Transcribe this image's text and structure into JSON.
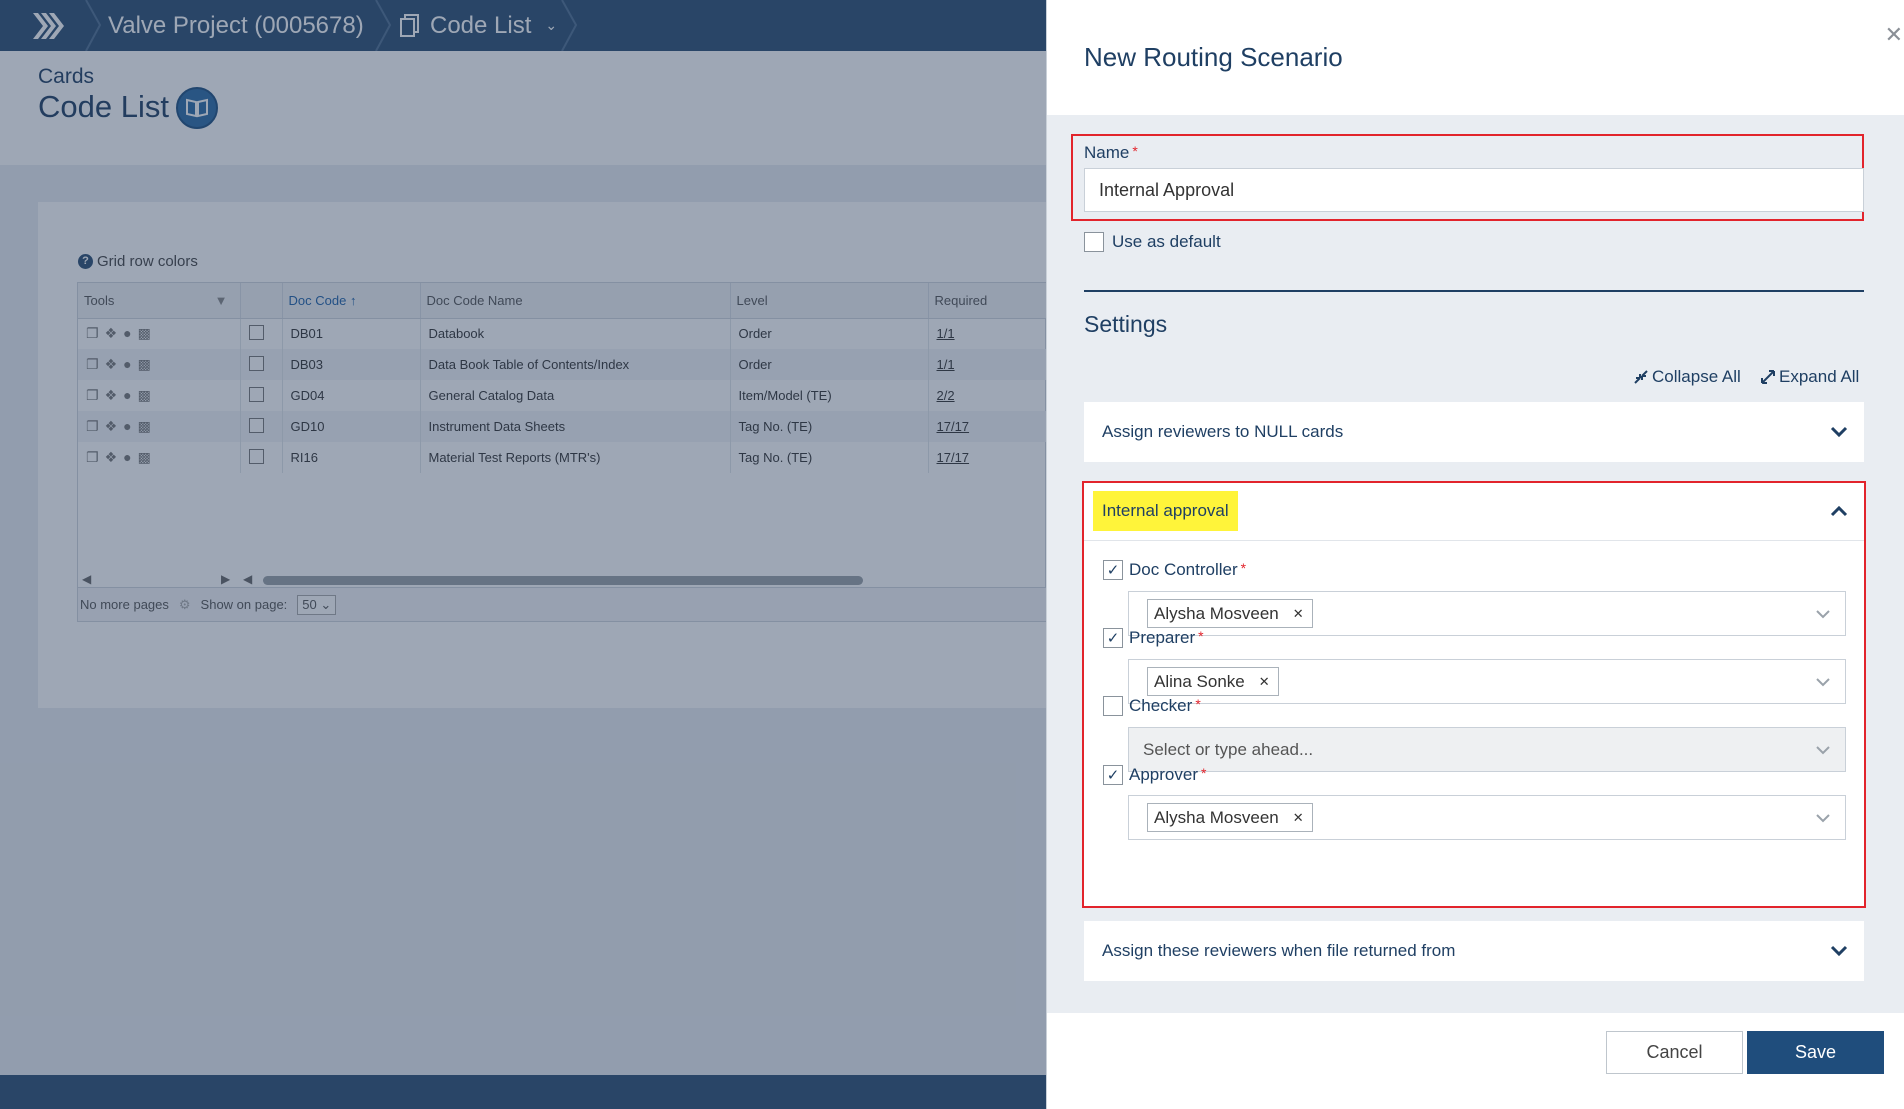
{
  "breadcrumb": {
    "project": "Valve Project (0005678)",
    "page": "Code List"
  },
  "page_header": {
    "subtitle": "Cards",
    "title": "Code List"
  },
  "grid": {
    "row_colors_label": "Grid row colors",
    "columns": [
      "Tools",
      "",
      "Doc Code",
      "Doc Code Name",
      "Level",
      "Required"
    ],
    "rows": [
      {
        "code": "DB01",
        "name": "Databook",
        "level": "Order",
        "required": "1/1"
      },
      {
        "code": "DB03",
        "name": "Data Book Table of Contents/Index",
        "level": "Order",
        "required": "1/1"
      },
      {
        "code": "GD04",
        "name": "General Catalog Data",
        "level": "Item/Model (TE)",
        "required": "2/2"
      },
      {
        "code": "GD10",
        "name": "Instrument Data Sheets",
        "level": "Tag No. (TE)",
        "required": "17/17"
      },
      {
        "code": "RI16",
        "name": "Material Test Reports (MTR's)",
        "level": "Tag No. (TE)",
        "required": "17/17"
      }
    ],
    "footer": {
      "no_more_pages": "No more pages",
      "show_on_page": "Show on page:",
      "page_size": "50"
    }
  },
  "dialog": {
    "title": "New Routing Scenario",
    "name_label": "Name",
    "name_value": "Internal Approval",
    "use_default_label": "Use as default",
    "settings_title": "Settings",
    "collapse_all": "Collapse All",
    "expand_all": "Expand All",
    "sections": {
      "null_cards": "Assign reviewers to NULL cards",
      "internal": "Internal approval",
      "returned": "Assign these reviewers when file returned from"
    },
    "roles": [
      {
        "label": "Doc Controller",
        "checked": true,
        "value": "Alysha Mosveen"
      },
      {
        "label": "Preparer",
        "checked": true,
        "value": "Alina Sonke"
      },
      {
        "label": "Checker",
        "checked": false,
        "placeholder": "Select or type ahead..."
      },
      {
        "label": "Approver",
        "checked": true,
        "value": "Alysha Mosveen"
      }
    ],
    "cancel": "Cancel",
    "save": "Save"
  },
  "colors": {
    "navy": "#1f3f63",
    "topbar": "#2b4e72",
    "highlight": "#fff43a",
    "annotation_red": "#e2242c",
    "save_button": "#1f4d7c"
  }
}
